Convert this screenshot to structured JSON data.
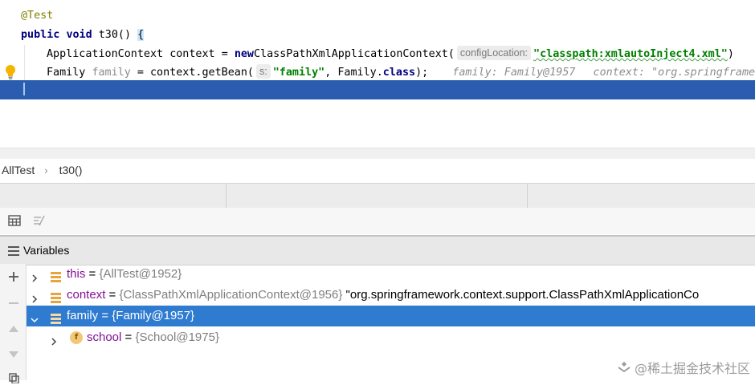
{
  "editor": {
    "annotation": "@Test",
    "method": {
      "kw_public": "public",
      "kw_void": "void",
      "name_sig": "t30()",
      "brace": "{"
    },
    "line3": {
      "type": "ApplicationContext",
      "var": "context",
      "assign": "=",
      "kw_new": "new",
      "ctor": "ClassPathXmlApplicationContext(",
      "hint": "configLocation:",
      "arg": "\"classpath:xmlautoInject4.xml\"",
      "tail": ")"
    },
    "line4": {
      "type": "Family",
      "var": "family",
      "call": "= context.getBean(",
      "hint": "s:",
      "arg": "\"family\"",
      "comma": ", Family.",
      "kw_class": "class",
      "tail": ");",
      "inline1": "family: Family@1957",
      "inline2": "context: \"org.springframework"
    }
  },
  "breadcrumb": {
    "items": [
      "AllTest",
      "t30()"
    ]
  },
  "variables": {
    "title": "Variables",
    "rows": [
      {
        "name": "this",
        "eq": " = ",
        "type": "{AllTest@1952}",
        "extra": ""
      },
      {
        "name": "context",
        "eq": " = ",
        "type": "{ClassPathXmlApplicationContext@1956}",
        "extra": " \"org.springframework.context.support.ClassPathXmlApplicationCo"
      },
      {
        "name": "family",
        "eq": " = ",
        "type": "{Family@1957}",
        "extra": ""
      },
      {
        "name": "school",
        "eq": " = ",
        "type": "{School@1975}",
        "extra": ""
      }
    ],
    "field_badge": "f"
  },
  "watermark": "@稀土掘金技术社区",
  "colors": {
    "accent": "#2f7bd0",
    "exec_line": "#2a5db0"
  }
}
